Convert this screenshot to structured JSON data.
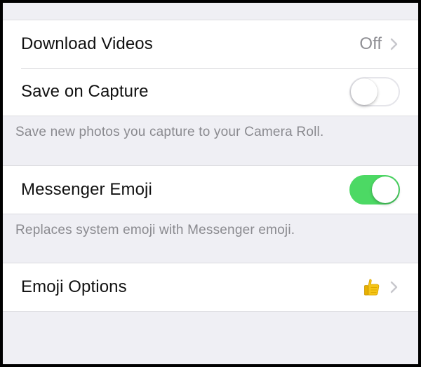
{
  "settings": {
    "download_videos": {
      "label": "Download Videos",
      "value": "Off"
    },
    "save_on_capture": {
      "label": "Save on Capture",
      "enabled": false
    },
    "save_footer": "Save new photos you capture to your Camera Roll.",
    "messenger_emoji": {
      "label": "Messenger Emoji",
      "enabled": true
    },
    "emoji_footer": "Replaces system emoji with Messenger emoji.",
    "emoji_options": {
      "label": "Emoji Options",
      "icon": "thumbs-up-icon"
    }
  },
  "colors": {
    "background": "#efeff4",
    "toggle_on": "#4cd964",
    "secondary_text": "#8e8e93",
    "thumb_yellow": "#f5c518"
  }
}
